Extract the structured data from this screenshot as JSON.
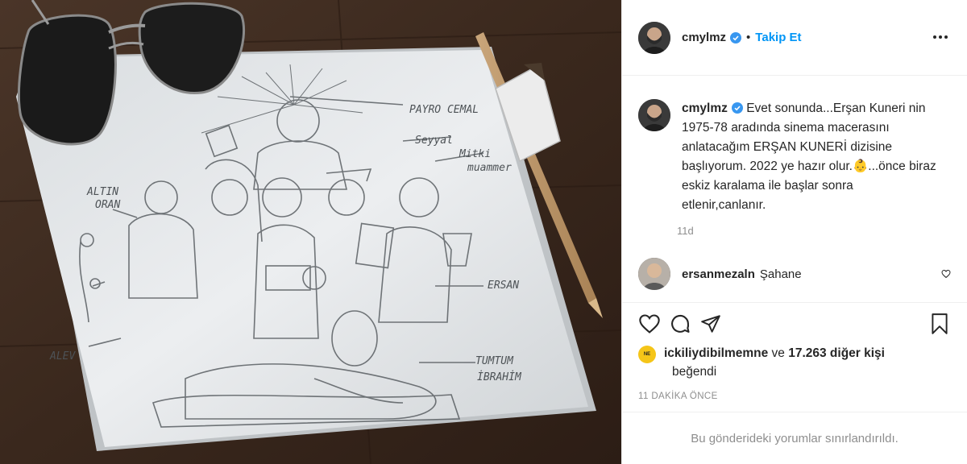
{
  "post": {
    "username": "cmylmz",
    "follow_label": "Takip Et",
    "separator": "•",
    "caption": "Evet sonunda...Erşan Kuneri nin 1975-78 aradında sinema macerasını anlatacağım ERŞAN KUNERİ dizisine başlıyorum. 2022 ye hazır olur.",
    "caption_emoji": "👶",
    "caption_rest": "...önce biraz eskiz karalama ile başlar sonra etlenir,canlanır.",
    "time_ago": "11d",
    "posted_ago": "11 DAKİKA ÖNCE",
    "restricted_text": "Bu gönderideki yorumlar sınırlandırıldı."
  },
  "next_comment": {
    "username": "ersanmezaln",
    "text": "Şahane"
  },
  "likes": {
    "avatar_text": "NE",
    "liker": "ickiliydibilmemne",
    "connector": "ve",
    "count": "17.263 diğer kişi",
    "suffix": "beğendi"
  },
  "sketch_labels": {
    "altin_oran_1": "ALTIN",
    "altin_oran_2": "ORAN",
    "payro": "PAYRO CEMAL",
    "seyyal": "Seyyal",
    "mitki_1": "Mitki",
    "mitki_2": "muammer",
    "ersan": "ERSAN",
    "alev": "ALEV",
    "tumtum_1": "TUMTUM",
    "tumtum_2": "İBRAHİM"
  },
  "colors": {
    "accent": "#0095f6",
    "text": "#262626",
    "muted": "#8e8e8e",
    "border": "#efefef",
    "wood": "#3b2a20"
  },
  "icons": [
    "more-icon",
    "verified-icon",
    "heart-icon",
    "comment-icon",
    "share-icon",
    "bookmark-icon"
  ]
}
